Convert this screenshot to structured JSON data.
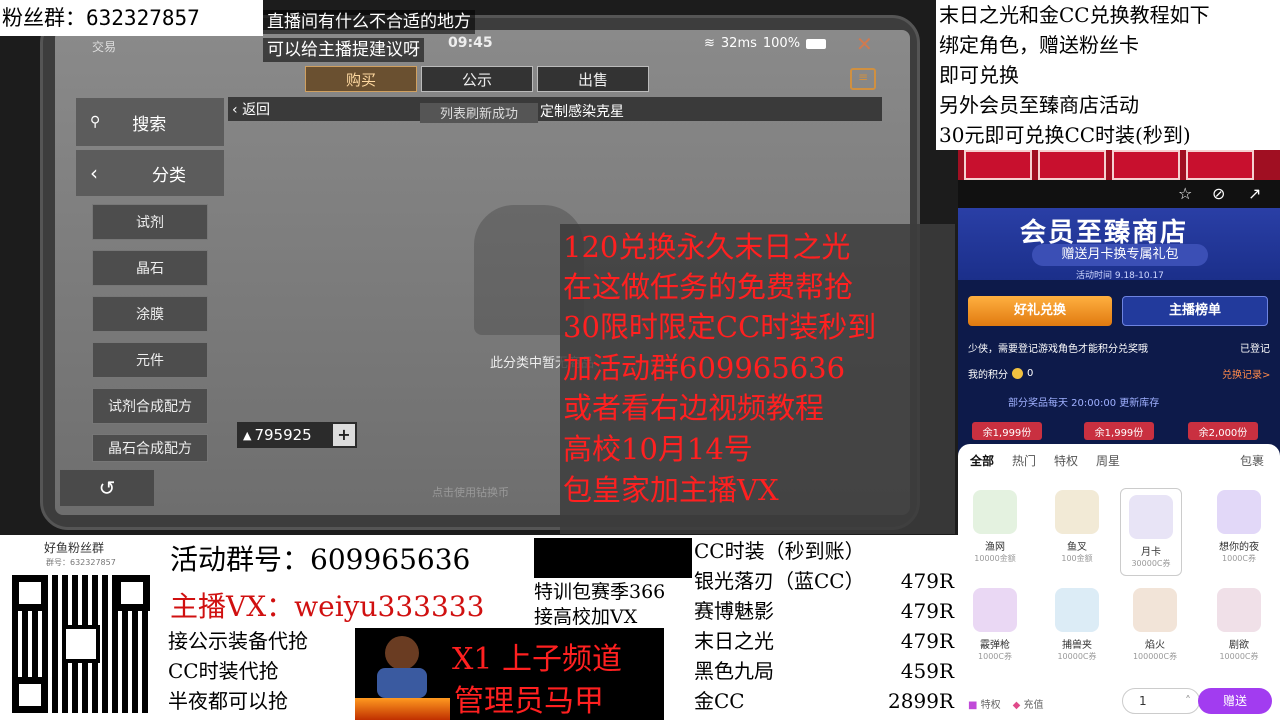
{
  "fan_group": "粉丝群：632327857",
  "suggestion_overlay": [
    "直播间有什么不合适的地方",
    "可以给主播提建议呀"
  ],
  "game": {
    "trade_label": "交易",
    "time": "09:45",
    "network": "32ms",
    "battery": "100%",
    "tabs": [
      "购买",
      "公示",
      "出售"
    ],
    "search_label": "搜索",
    "category_label": "分类",
    "back_label": "返回",
    "refresh_toast": "列表刷新成功",
    "item_title": "定制感染克星",
    "categories": [
      "试剂",
      "晶石",
      "涂膜",
      "元件",
      "试剂合成配方",
      "晶石合成配方"
    ],
    "empty_message": "此分类中暂无商品",
    "currency_amount": "795925",
    "footer_hint": "点击使用钻换币"
  },
  "promo_lines": [
    "120兑换永久末日之光",
    "在这做任务的免费帮抢",
    "30限时限定CC时装秒到",
    "加活动群609965636",
    "或者看右边视频教程",
    "高校10月14号",
    "包皇家加主播VX"
  ],
  "tutorial_lines": [
    "末日之光和金CC兑换教程如下",
    "绑定角色，赠送粉丝卡",
    "即可兑换",
    "另外会员至臻商店活动",
    "30元即可兑换CC时装(秒到)"
  ],
  "store": {
    "banner_title": "会员至臻商店",
    "banner_sub": "赠送月卡换专属礼包",
    "period": "活动时间 9.18-10.17",
    "tab_exchange": "好礼兑换",
    "tab_ranking": "主播榜单",
    "notice": "少侠，需要登记游戏角色才能积分兑奖哦",
    "registered": "已登记",
    "points_label": "我的积分",
    "points_value": "0",
    "records": "兑换记录>",
    "restock": "部分奖品每天 20:00:00 更新库存",
    "remain": [
      "余1,999份",
      "余1,999份",
      "余2,000份"
    ],
    "filters": [
      "全部",
      "热门",
      "特权",
      "周星"
    ],
    "bag": "包裹",
    "items_row1": [
      {
        "name": "渔网",
        "price": "10000金额"
      },
      {
        "name": "鱼叉",
        "price": "100金额"
      },
      {
        "name": "月卡",
        "price": "30000C券"
      },
      {
        "name": "想你的夜",
        "price": "1000C券"
      }
    ],
    "items_row2": [
      {
        "name": "霰弹枪",
        "price": "1000C券"
      },
      {
        "name": "捕兽夹",
        "price": "10000C券"
      },
      {
        "name": "焰火",
        "price": "100000C券"
      },
      {
        "name": "剧欲",
        "price": "10000C券"
      }
    ],
    "qty": "1",
    "gift_btn": "赠送",
    "bottom_left": [
      "特权",
      "充值"
    ]
  },
  "bottom": {
    "qr_title": "好鱼粉丝群",
    "qr_sub": "群号：632327857",
    "activity_group": "活动群号：609965636",
    "anchor_vx": "主播VX：weiyu333333",
    "services": [
      "接公示装备代抢",
      "CC时装代抢",
      "半夜都可以抢"
    ],
    "training": [
      "特训包赛季366",
      "接高校加VX"
    ],
    "channel": [
      "X1 上子频道",
      "管理员马甲"
    ],
    "price_title": "CC时装（秒到账）",
    "price_list": [
      {
        "name": "银光落刃（蓝CC）",
        "price": "479R"
      },
      {
        "name": "赛博魅影",
        "price": "479R"
      },
      {
        "name": "末日之光",
        "price": "479R"
      },
      {
        "name": "黑色九局",
        "price": "459R"
      },
      {
        "name": "金CC",
        "price": "2899R"
      }
    ]
  },
  "colors": {
    "promo_red": "#ff2020",
    "anchor_red": "#d01010",
    "store_blue": "#1b2f8a",
    "gift_purple": "#a23cf0"
  }
}
